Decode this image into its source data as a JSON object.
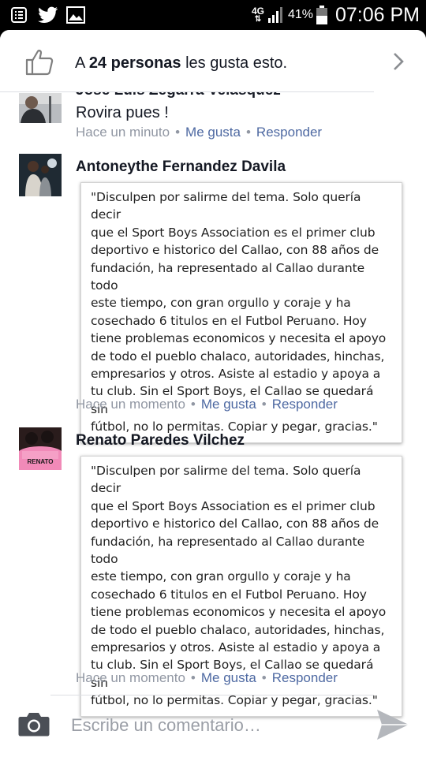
{
  "status_bar": {
    "network": "4G",
    "battery": "41%",
    "time": "07:06 PM",
    "icons": [
      "notes-icon",
      "twitter-icon",
      "gallery-icon"
    ]
  },
  "likes": {
    "prefix": "A",
    "count_text": "24 personas",
    "suffix": "les gusta esto."
  },
  "comments": [
    {
      "author": "José Luis Zegarra Velásquez",
      "text": "Rovira pues !",
      "time": "Hace un minuto",
      "like_label": "Me gusta",
      "reply_label": "Responder"
    },
    {
      "author": "Antoneythe Fernandez Davila",
      "quote_lines": [
        "\"Disculpen por salirme del tema. Solo quería decir",
        "que el Sport Boys Association es el primer club",
        "deportivo e historico del Callao, con 88 años de",
        "fundación, ha representado al Callao durante todo",
        "este tiempo, con gran orgullo y coraje y ha",
        "cosechado 6 titulos en el Futbol Peruano. Hoy",
        "tiene problemas economicos y necesita el apoyo",
        "de todo el pueblo chalaco, autoridades, hinchas,",
        "empresarios y otros. Asiste al estadio y apoya a",
        "tu club. Sin el Sport Boys, el Callao se quedará sin",
        "fútbol, no lo permitas. Copiar y pegar, gracias.\""
      ],
      "time": "Hace un momento",
      "like_label": "Me gusta",
      "reply_label": "Responder"
    },
    {
      "author": "Renato Paredes Vilchez",
      "avatar_text": "RENATO",
      "quote_lines": [
        "\"Disculpen por salirme del tema. Solo quería decir",
        "que el Sport Boys Association es el primer club",
        "deportivo e historico del Callao, con 88 años de",
        "fundación, ha representado al Callao durante todo",
        "este tiempo, con gran orgullo y coraje y ha",
        "cosechado 6 titulos en el Futbol Peruano. Hoy",
        "tiene problemas economicos y necesita el apoyo",
        "de todo el pueblo chalaco, autoridades, hinchas,",
        "empresarios y otros. Asiste al estadio y apoya a",
        "tu club. Sin el Sport Boys, el Callao se quedará sin",
        "fútbol, no lo permitas. Copiar y pegar, gracias.\""
      ],
      "time": "Hace un momento",
      "like_label": "Me gusta",
      "reply_label": "Responder"
    }
  ],
  "composer": {
    "placeholder": "Escribe un comentario…"
  },
  "colors": {
    "link": "#4e69a2",
    "meta": "#9197a3",
    "text": "#141823"
  }
}
